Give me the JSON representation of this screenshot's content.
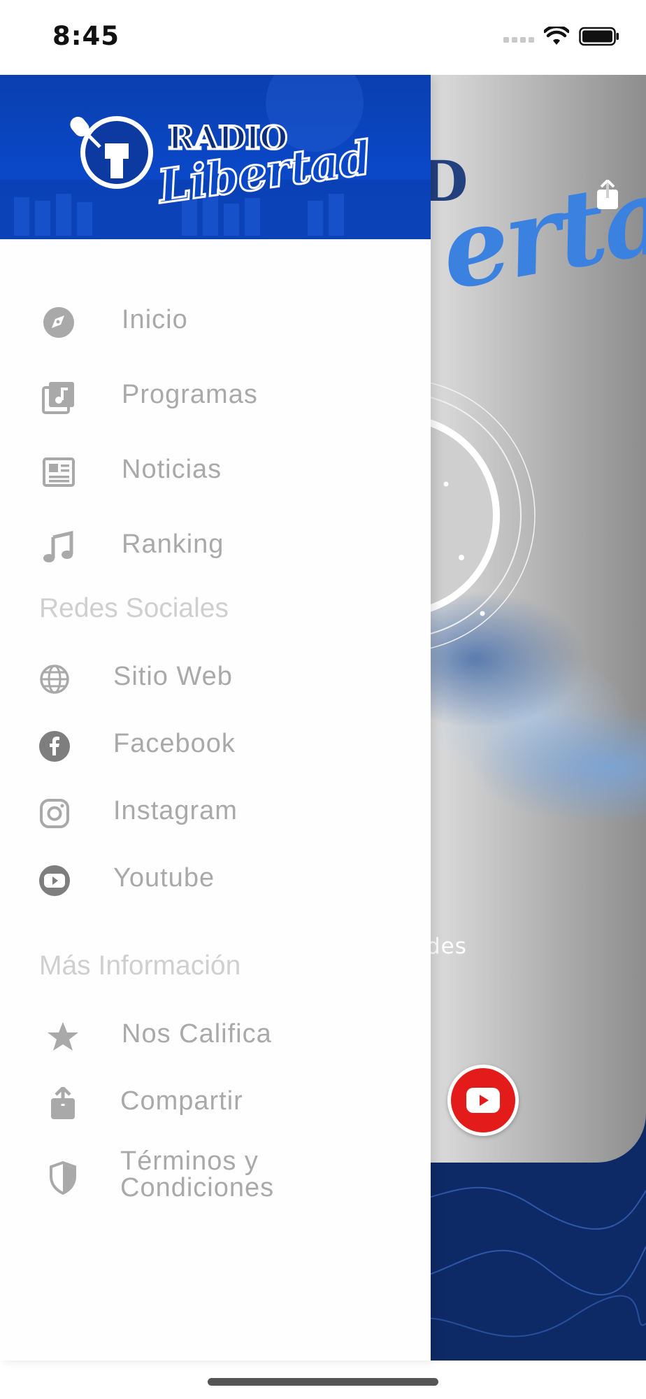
{
  "status_bar": {
    "time": "8:45"
  },
  "drawer": {
    "logo": {
      "line1": "RADIO",
      "line2": "Libertad"
    },
    "main_menu": [
      {
        "label": "Inicio",
        "icon": "compass-icon"
      },
      {
        "label": "Programas",
        "icon": "music-library-icon"
      },
      {
        "label": "Noticias",
        "icon": "newspaper-icon"
      },
      {
        "label": "Ranking",
        "icon": "music-note-icon"
      }
    ],
    "social_section": {
      "title": "Redes Sociales",
      "items": [
        {
          "label": "Sitio  Web",
          "icon": "globe-icon"
        },
        {
          "label": "Facebook",
          "icon": "facebook-icon"
        },
        {
          "label": "Instagram",
          "icon": "instagram-icon"
        },
        {
          "label": "Youtube",
          "icon": "youtube-icon"
        }
      ]
    },
    "info_section": {
      "title": "Más Información",
      "items": [
        {
          "label": "Nos  Califica",
          "icon": "star-icon"
        },
        {
          "label": "Compartir",
          "icon": "share-icon"
        },
        {
          "label_line1": "Términos  y",
          "label_line2": "Condiciones",
          "icon": "shield-icon"
        }
      ]
    }
  },
  "background": {
    "caption_fragment": "ades",
    "logo_fragment": "ertad"
  },
  "colors": {
    "drawer_header": "#0a48c8",
    "menu_text": "#a9a9a9",
    "section_text": "#cfcfcf",
    "bg_navy": "#0e2a66",
    "youtube_red": "#e41b1b"
  }
}
